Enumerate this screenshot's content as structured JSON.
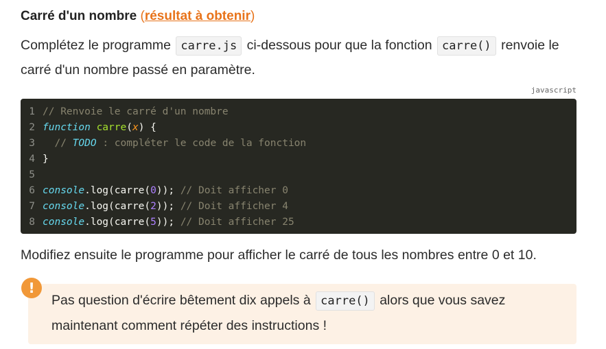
{
  "heading": {
    "title": "Carré d'un nombre",
    "paren_open": " (",
    "link": "résultat à obtenir",
    "paren_close": ")"
  },
  "intro": {
    "t1": "Complétez le programme",
    "file": "carre.js",
    "t2": "ci-dessous pour que la fonction",
    "fn": "carre()",
    "t3": "renvoie le carré d'un nombre passé en paramètre."
  },
  "code_block": {
    "language": "javascript",
    "line_numbers": [
      "1",
      "2",
      "3",
      "4",
      "5",
      "6",
      "7",
      "8"
    ],
    "l1_comment": "// Renvoie le carré d'un nombre",
    "l2_kw": "function",
    "l2_fn": "carre",
    "l2_arg": "x",
    "l3_prefix": "// ",
    "l3_todo": "TODO",
    "l3_rest": " : compléter le code de la fonction",
    "l4": "}",
    "console": "console",
    "log": ".log(",
    "call": "carre",
    "args": [
      "0",
      "2",
      "5"
    ],
    "comments": [
      "// Doit afficher 0",
      "// Doit afficher 4",
      "// Doit afficher 25"
    ]
  },
  "para2": "Modifiez ensuite le programme pour afficher le carré de tous les nombres entre 0 et 10.",
  "callout": {
    "icon": "!",
    "t1": "Pas question d'écrire bêtement dix appels à",
    "fn": "carre()",
    "t2": "alors que vous savez maintenant comment répéter des instructions !",
    "bg_color": "#fdf1e5",
    "icon_color": "#f19838"
  }
}
